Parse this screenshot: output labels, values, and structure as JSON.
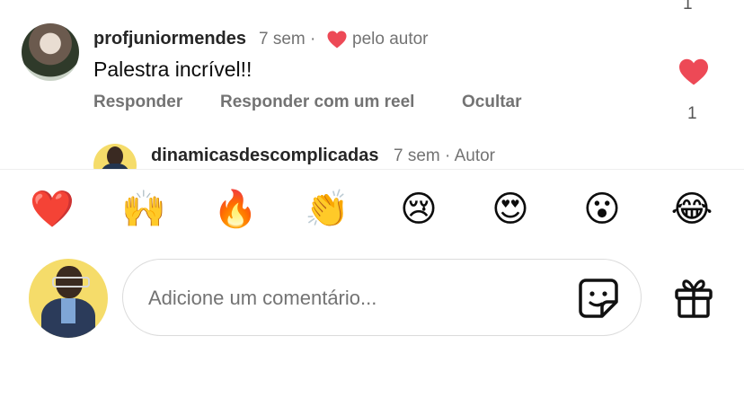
{
  "top_like_count": "1",
  "comment": {
    "username": "profjuniormendes",
    "time": "7 sem ·",
    "by_author": "pelo autor",
    "text": "Palestra incrível!!",
    "like_count": "1",
    "actions": {
      "reply": "Responder",
      "reply_reel": "Responder com um reel",
      "hide": "Ocultar"
    }
  },
  "reply": {
    "username": "dinamicasdescomplicadas",
    "meta": "7 sem · Autor"
  },
  "emojis": [
    "❤️",
    "🙌",
    "🔥",
    "👏",
    "😢",
    "😍",
    "😮",
    "😂"
  ],
  "composer": {
    "placeholder": "Adicione um comentário..."
  },
  "icons": {
    "liked": "heart-icon",
    "sticker": "sticker-icon",
    "gift": "gift-icon"
  },
  "colors": {
    "heart": "#ed4956",
    "secondary_text": "#737373",
    "avatar_bg": "#f5dc6a"
  }
}
